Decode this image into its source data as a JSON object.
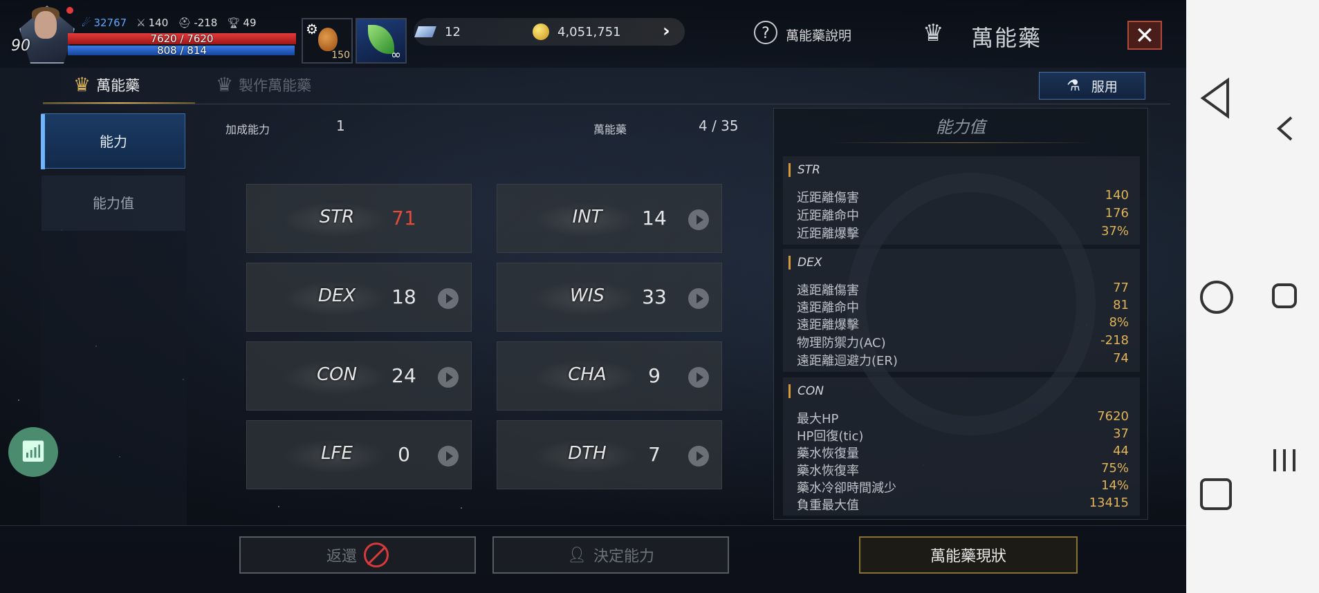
{
  "hud": {
    "level": "90",
    "stat_exp": "32767",
    "stat_atk": "140",
    "stat_ac": "-218",
    "stat_trophy": "49",
    "hp": "7620 / 7620",
    "mp": "808 / 814",
    "potion_count": "150",
    "leaf_count": "∞",
    "gem": "12",
    "gold": "4,051,751",
    "help_label": "萬能藥說明",
    "title": "萬能藥",
    "close": "✕"
  },
  "tabs": [
    {
      "label": "萬能藥",
      "active": true
    },
    {
      "label": "製作萬能藥",
      "active": false
    }
  ],
  "use_button": "服用",
  "side_menu": [
    {
      "label": "能力",
      "active": true
    },
    {
      "label": "能力值",
      "active": false
    }
  ],
  "info": {
    "bonus_label": "加成能力",
    "bonus_value": "1",
    "elixir_label": "萬能藥",
    "elixir_value": "4 / 35"
  },
  "stats": [
    {
      "name": "STR",
      "value": "71",
      "highlight": true
    },
    {
      "name": "INT",
      "value": "14"
    },
    {
      "name": "DEX",
      "value": "18"
    },
    {
      "name": "WIS",
      "value": "33"
    },
    {
      "name": "CON",
      "value": "24"
    },
    {
      "name": "CHA",
      "value": "9"
    },
    {
      "name": "LFE",
      "value": "0"
    },
    {
      "name": "DTH",
      "value": "7"
    }
  ],
  "panel": {
    "title": "能力值",
    "groups": [
      {
        "header": "STR",
        "rows": [
          {
            "k": "近距離傷害",
            "v": "140"
          },
          {
            "k": "近距離命中",
            "v": "176"
          },
          {
            "k": "近距離爆擊",
            "v": "37%"
          }
        ]
      },
      {
        "header": "DEX",
        "rows": [
          {
            "k": "遠距離傷害",
            "v": "77"
          },
          {
            "k": "遠距離命中",
            "v": "81"
          },
          {
            "k": "遠距離爆擊",
            "v": "8%"
          },
          {
            "k": "物理防禦力(AC)",
            "v": "-218"
          },
          {
            "k": "遠距離迴避力(ER)",
            "v": "74"
          }
        ]
      },
      {
        "header": "CON",
        "rows": [
          {
            "k": "最大HP",
            "v": "7620"
          },
          {
            "k": "HP回復(tic)",
            "v": "37"
          },
          {
            "k": "藥水恢復量",
            "v": "44"
          },
          {
            "k": "藥水恢復率",
            "v": "75%"
          },
          {
            "k": "藥水冷卻時間減少",
            "v": "14%"
          },
          {
            "k": "負重最大值",
            "v": "13415"
          }
        ]
      }
    ]
  },
  "bottom": {
    "reset": "返還",
    "confirm": "決定能力",
    "status": "萬能藥現狀"
  },
  "colors": {
    "accent_gold": "#e0b457",
    "hp": "#e43a3a",
    "mp": "#3a7ae4",
    "highlight_red": "#e34a3a"
  }
}
